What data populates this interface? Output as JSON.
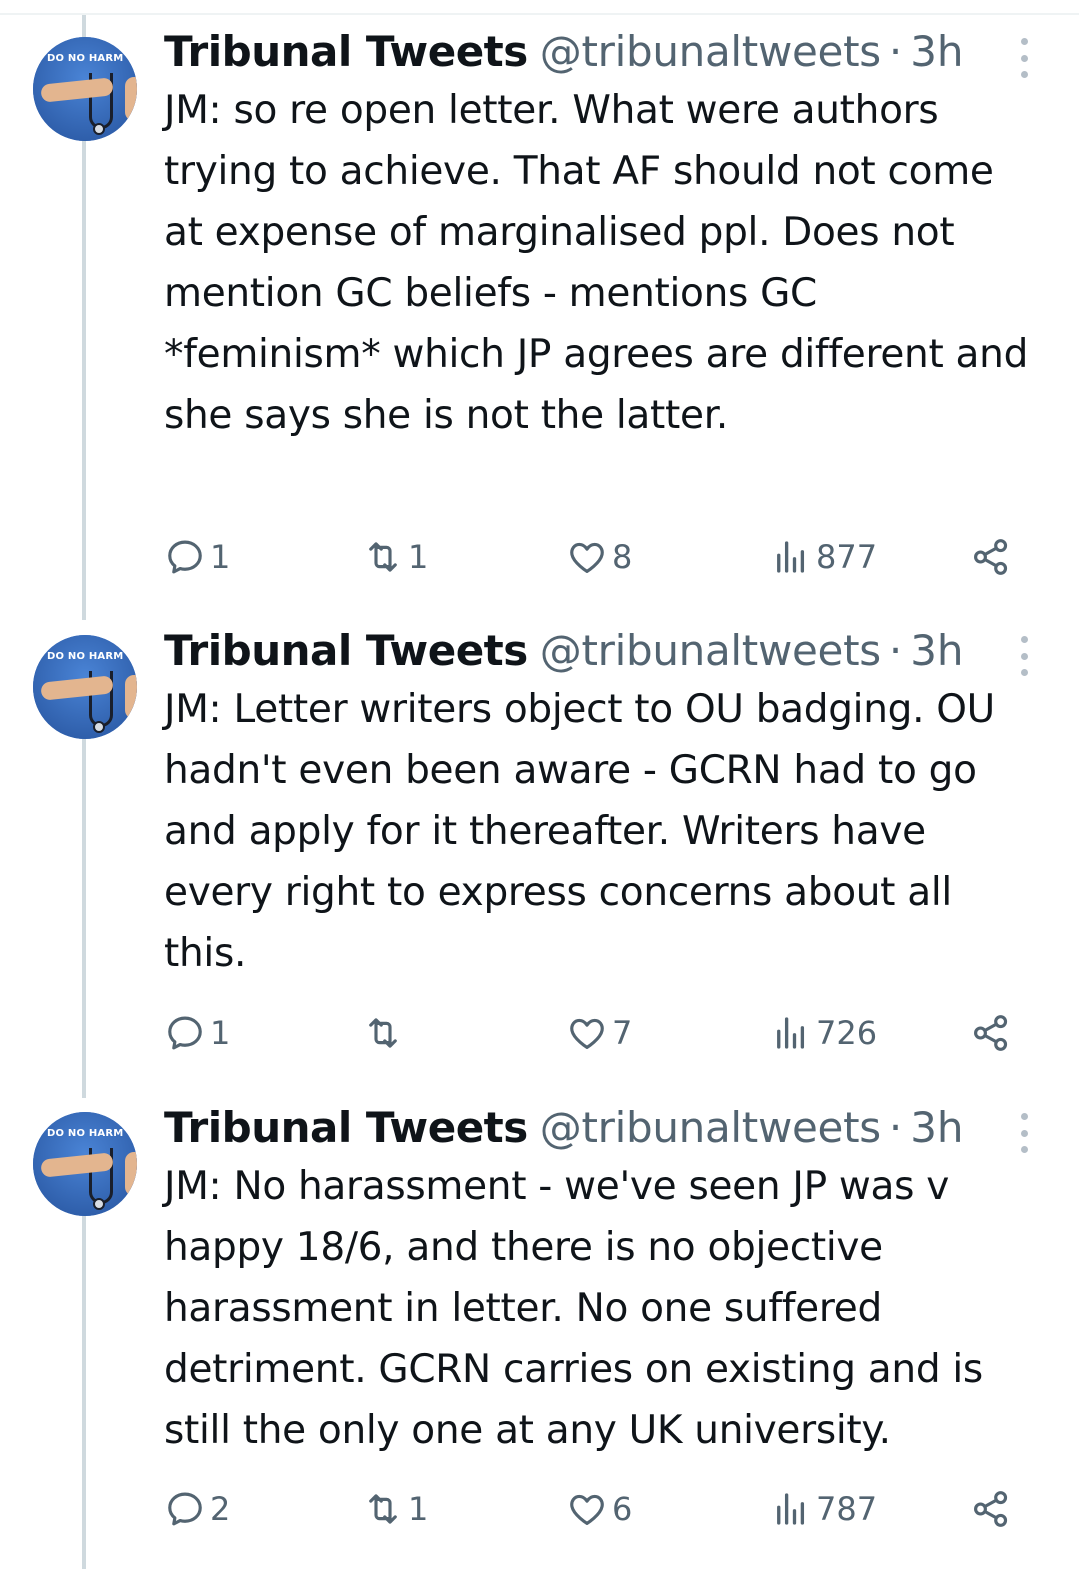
{
  "tweets": [
    {
      "avatar_label": "DO NO HARM",
      "display_name": "Tribunal Tweets",
      "handle": "@tribunaltweets",
      "separator": "·",
      "time": "3h",
      "text": "JM: so re open letter. What were authors trying to achieve. That AF should not come at expense of marginalised ppl. Does not mention GC beliefs - mentions GC *feminism* which JP agrees are different and she says she is not the latter.",
      "replies": "1",
      "retweets": "1",
      "likes": "8",
      "views": "877"
    },
    {
      "avatar_label": "DO NO HARM",
      "display_name": "Tribunal Tweets",
      "handle": "@tribunaltweets",
      "separator": "·",
      "time": "3h",
      "text": "JM: Letter writers object to OU badging. OU hadn't even been aware - GCRN had to go and apply for it thereafter. Writers have every right to express concerns about all this.",
      "replies": "1",
      "retweets": "",
      "likes": "7",
      "views": "726"
    },
    {
      "avatar_label": "DO NO HARM",
      "display_name": "Tribunal Tweets",
      "handle": "@tribunaltweets",
      "separator": "·",
      "time": "3h",
      "text": "JM: No harassment - we've seen JP was v happy 18/6, and there is no objective harassment in letter. No one suffered detriment. GCRN carries on existing and is still the only one at any UK university.",
      "replies": "2",
      "retweets": "1",
      "likes": "6",
      "views": "787"
    }
  ],
  "icons": {
    "reply": "reply-icon",
    "retweet": "retweet-icon",
    "like": "heart-icon",
    "views": "views-icon",
    "share": "share-icon",
    "more": "more-icon"
  },
  "colors": {
    "text": "#0f1419",
    "secondary": "#536471",
    "thread_line": "#cfd9de",
    "avatar_blue": "#3b6fc2"
  }
}
